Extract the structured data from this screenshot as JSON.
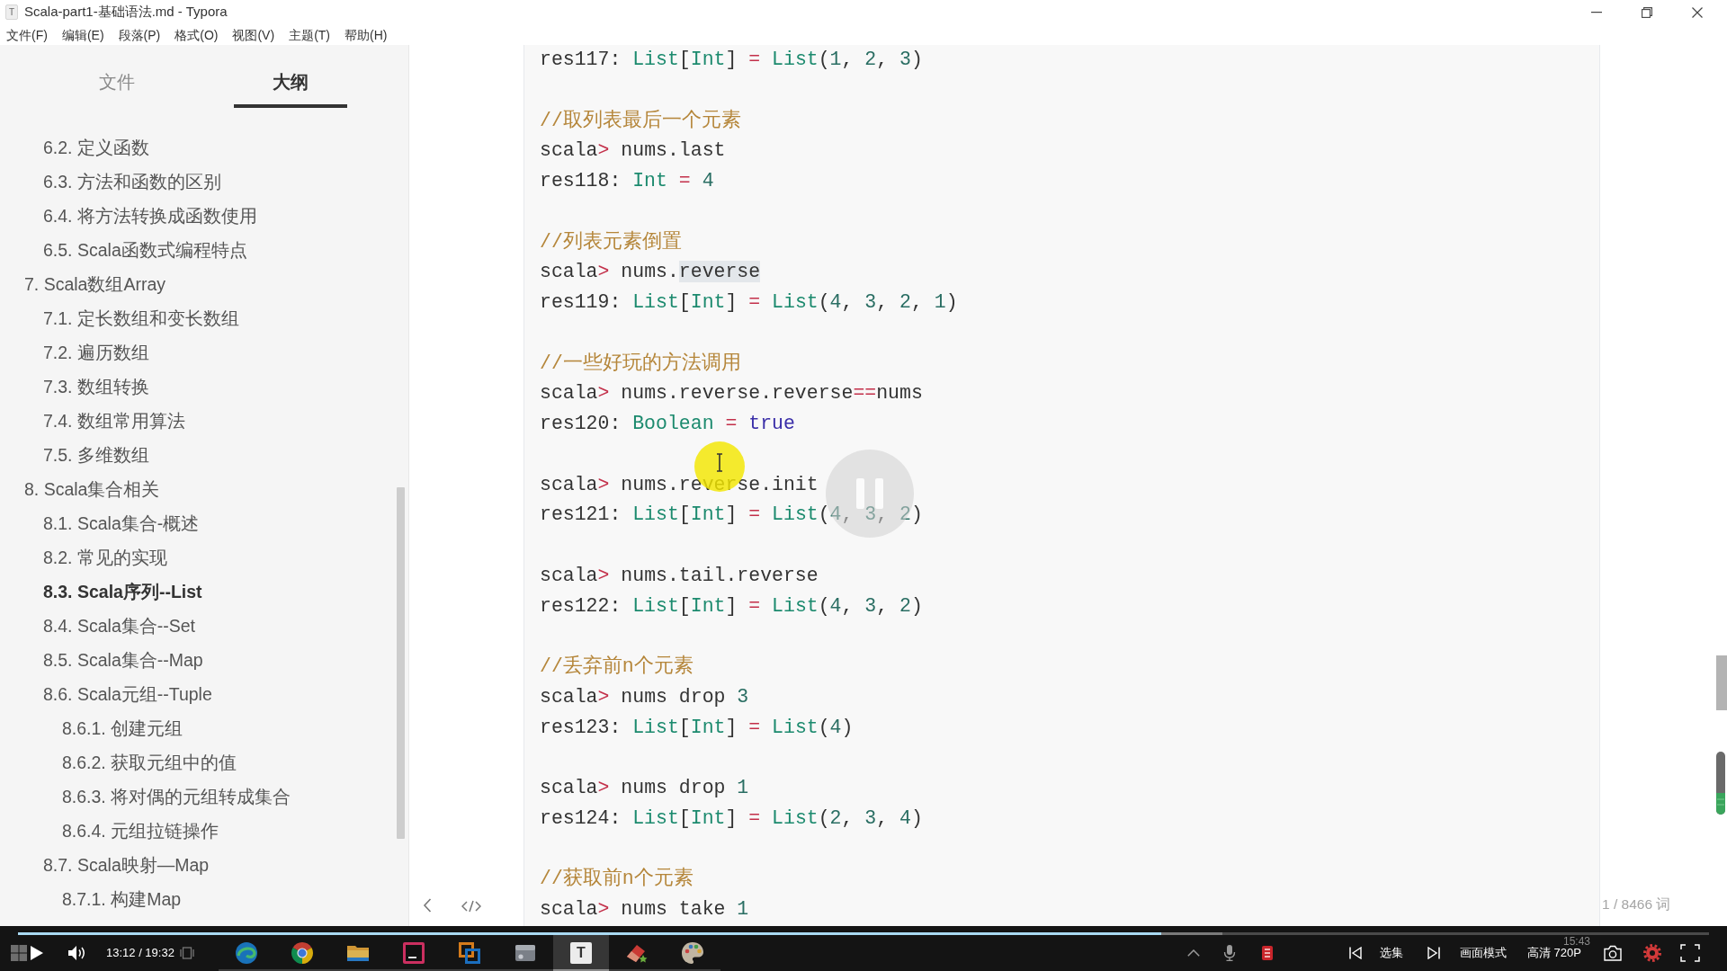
{
  "window": {
    "icon_glyph": "T",
    "title": "Scala-part1-基础语法.md - Typora"
  },
  "menu": [
    "文件(F)",
    "编辑(E)",
    "段落(P)",
    "格式(O)",
    "视图(V)",
    "主题(T)",
    "帮助(H)"
  ],
  "sidebar": {
    "tabs": [
      {
        "label": "文件",
        "selected": false
      },
      {
        "label": "大纲",
        "selected": true
      }
    ],
    "outline": [
      {
        "children": [
          {
            "label": "6.2. 定义函数",
            "selected": false
          },
          {
            "label": "6.3. 方法和函数的区别",
            "selected": false
          },
          {
            "label": "6.4. 将方法转换成函数使用",
            "selected": false
          },
          {
            "label": "6.5. Scala函数式编程特点",
            "selected": false
          }
        ]
      },
      {
        "label": "7. Scala数组Array",
        "selected": false,
        "children": [
          {
            "label": "7.1. 定长数组和变长数组",
            "selected": false
          },
          {
            "label": "7.2. 遍历数组",
            "selected": false
          },
          {
            "label": "7.3. 数组转换",
            "selected": false
          },
          {
            "label": "7.4. 数组常用算法",
            "selected": false
          },
          {
            "label": "7.5. 多维数组",
            "selected": false
          }
        ]
      },
      {
        "label": "8. Scala集合相关",
        "selected": false,
        "children": [
          {
            "label": "8.1. Scala集合-概述",
            "selected": false
          },
          {
            "label": "8.2. 常见的实现",
            "selected": false
          },
          {
            "label": "8.3. Scala序列--List",
            "selected": true
          },
          {
            "label": "8.4. Scala集合--Set",
            "selected": false
          },
          {
            "label": "8.5. Scala集合--Map",
            "selected": false
          },
          {
            "label": "8.6. Scala元组--Tuple",
            "selected": false,
            "children": [
              {
                "label": "8.6.1. 创建元组",
                "selected": false
              },
              {
                "label": "8.6.2. 获取元组中的值",
                "selected": false
              },
              {
                "label": "8.6.3. 将对偶的元组转成集合",
                "selected": false
              },
              {
                "label": "8.6.4. 元组拉链操作",
                "selected": false
              }
            ]
          },
          {
            "label": "8.7. Scala映射—Map",
            "selected": false,
            "children": [
              {
                "label": "8.7.1. 构建Map",
                "selected": false
              }
            ]
          }
        ]
      }
    ]
  },
  "editor": {
    "code_block": [
      {
        "lines": [
          {
            "tokens": [
              {
                "text": "res117: ",
                "kind": "plain"
              },
              {
                "text": "List",
                "kind": "type"
              },
              {
                "text": "[",
                "kind": "plain"
              },
              {
                "text": "Int",
                "kind": "type"
              },
              {
                "text": "] ",
                "kind": "plain"
              },
              {
                "text": "= ",
                "kind": "operator"
              },
              {
                "text": "List",
                "kind": "type"
              },
              {
                "text": "(",
                "kind": "plain"
              },
              {
                "text": "1",
                "kind": "number"
              },
              {
                "text": ", ",
                "kind": "plain"
              },
              {
                "text": "2",
                "kind": "number"
              },
              {
                "text": ", ",
                "kind": "plain"
              },
              {
                "text": "3",
                "kind": "number"
              },
              {
                "text": ")",
                "kind": "plain"
              }
            ]
          }
        ]
      },
      {
        "lines": [
          {
            "tokens": [
              {
                "text": "//取列表最后一个元素",
                "kind": "comment"
              }
            ]
          },
          {
            "tokens": [
              {
                "text": "scala",
                "kind": "plain"
              },
              {
                "text": ">",
                "kind": "operator"
              },
              {
                "text": " nums.last",
                "kind": "plain"
              }
            ]
          },
          {
            "tokens": [
              {
                "text": "res118: ",
                "kind": "plain"
              },
              {
                "text": "Int",
                "kind": "type"
              },
              {
                "text": " = ",
                "kind": "operator"
              },
              {
                "text": "4",
                "kind": "number"
              }
            ]
          }
        ]
      },
      {
        "lines": [
          {
            "tokens": [
              {
                "text": "//列表元素倒置",
                "kind": "comment"
              }
            ]
          },
          {
            "tokens": [
              {
                "text": "scala",
                "kind": "plain"
              },
              {
                "text": ">",
                "kind": "operator"
              },
              {
                "text": " nums.",
                "kind": "plain"
              },
              {
                "text": "reverse",
                "kind": "match"
              }
            ]
          },
          {
            "tokens": [
              {
                "text": "res119: ",
                "kind": "plain"
              },
              {
                "text": "List",
                "kind": "type"
              },
              {
                "text": "[",
                "kind": "plain"
              },
              {
                "text": "Int",
                "kind": "type"
              },
              {
                "text": "] ",
                "kind": "plain"
              },
              {
                "text": "= ",
                "kind": "operator"
              },
              {
                "text": "List",
                "kind": "type"
              },
              {
                "text": "(",
                "kind": "plain"
              },
              {
                "text": "4",
                "kind": "number"
              },
              {
                "text": ", ",
                "kind": "plain"
              },
              {
                "text": "3",
                "kind": "number"
              },
              {
                "text": ", ",
                "kind": "plain"
              },
              {
                "text": "2",
                "kind": "number"
              },
              {
                "text": ", ",
                "kind": "plain"
              },
              {
                "text": "1",
                "kind": "number"
              },
              {
                "text": ")",
                "kind": "plain"
              }
            ]
          }
        ]
      },
      {
        "lines": [
          {
            "tokens": [
              {
                "text": "//一些好玩的方法调用",
                "kind": "comment"
              }
            ]
          },
          {
            "tokens": [
              {
                "text": "scala",
                "kind": "plain"
              },
              {
                "text": ">",
                "kind": "operator"
              },
              {
                "text": " nums.reverse.reverse",
                "kind": "plain"
              },
              {
                "text": "==",
                "kind": "operator"
              },
              {
                "text": "nums",
                "kind": "plain"
              }
            ]
          },
          {
            "tokens": [
              {
                "text": "res120: ",
                "kind": "plain"
              },
              {
                "text": "Boolean",
                "kind": "type"
              },
              {
                "text": " = ",
                "kind": "operator"
              },
              {
                "text": "true",
                "kind": "atom"
              }
            ]
          }
        ]
      },
      {
        "lines": [
          {
            "tokens": [
              {
                "text": "scala",
                "kind": "plain"
              },
              {
                "text": ">",
                "kind": "operator"
              },
              {
                "text": " nums.reverse.init",
                "kind": "plain"
              }
            ]
          },
          {
            "tokens": [
              {
                "text": "res121: ",
                "kind": "plain"
              },
              {
                "text": "List",
                "kind": "type"
              },
              {
                "text": "[",
                "kind": "plain"
              },
              {
                "text": "Int",
                "kind": "type"
              },
              {
                "text": "] ",
                "kind": "plain"
              },
              {
                "text": "= ",
                "kind": "operator"
              },
              {
                "text": "List",
                "kind": "type"
              },
              {
                "text": "(",
                "kind": "plain"
              },
              {
                "text": "4",
                "kind": "number"
              },
              {
                "text": ", ",
                "kind": "plain"
              },
              {
                "text": "3",
                "kind": "number"
              },
              {
                "text": ", ",
                "kind": "plain"
              },
              {
                "text": "2",
                "kind": "number"
              },
              {
                "text": ")",
                "kind": "plain"
              }
            ]
          }
        ]
      },
      {
        "lines": [
          {
            "tokens": [
              {
                "text": "scala",
                "kind": "plain"
              },
              {
                "text": ">",
                "kind": "operator"
              },
              {
                "text": " nums.tail.reverse",
                "kind": "plain"
              }
            ]
          },
          {
            "tokens": [
              {
                "text": "res122: ",
                "kind": "plain"
              },
              {
                "text": "List",
                "kind": "type"
              },
              {
                "text": "[",
                "kind": "plain"
              },
              {
                "text": "Int",
                "kind": "type"
              },
              {
                "text": "] ",
                "kind": "plain"
              },
              {
                "text": "= ",
                "kind": "operator"
              },
              {
                "text": "List",
                "kind": "type"
              },
              {
                "text": "(",
                "kind": "plain"
              },
              {
                "text": "4",
                "kind": "number"
              },
              {
                "text": ", ",
                "kind": "plain"
              },
              {
                "text": "3",
                "kind": "number"
              },
              {
                "text": ", ",
                "kind": "plain"
              },
              {
                "text": "2",
                "kind": "number"
              },
              {
                "text": ")",
                "kind": "plain"
              }
            ]
          }
        ]
      },
      {
        "lines": [
          {
            "tokens": [
              {
                "text": "//丢弃前n个元素",
                "kind": "comment"
              }
            ]
          },
          {
            "tokens": [
              {
                "text": "scala",
                "kind": "plain"
              },
              {
                "text": ">",
                "kind": "operator"
              },
              {
                "text": " nums drop ",
                "kind": "plain"
              },
              {
                "text": "3",
                "kind": "number"
              }
            ]
          },
          {
            "tokens": [
              {
                "text": "res123: ",
                "kind": "plain"
              },
              {
                "text": "List",
                "kind": "type"
              },
              {
                "text": "[",
                "kind": "plain"
              },
              {
                "text": "Int",
                "kind": "type"
              },
              {
                "text": "] ",
                "kind": "plain"
              },
              {
                "text": "= ",
                "kind": "operator"
              },
              {
                "text": "List",
                "kind": "type"
              },
              {
                "text": "(",
                "kind": "plain"
              },
              {
                "text": "4",
                "kind": "number"
              },
              {
                "text": ")",
                "kind": "plain"
              }
            ]
          }
        ]
      },
      {
        "lines": [
          {
            "tokens": [
              {
                "text": "scala",
                "kind": "plain"
              },
              {
                "text": ">",
                "kind": "operator"
              },
              {
                "text": " nums drop ",
                "kind": "plain"
              },
              {
                "text": "1",
                "kind": "number"
              }
            ]
          },
          {
            "tokens": [
              {
                "text": "res124: ",
                "kind": "plain"
              },
              {
                "text": "List",
                "kind": "type"
              },
              {
                "text": "[",
                "kind": "plain"
              },
              {
                "text": "Int",
                "kind": "type"
              },
              {
                "text": "] ",
                "kind": "plain"
              },
              {
                "text": "= ",
                "kind": "operator"
              },
              {
                "text": "List",
                "kind": "type"
              },
              {
                "text": "(",
                "kind": "plain"
              },
              {
                "text": "2",
                "kind": "number"
              },
              {
                "text": ", ",
                "kind": "plain"
              },
              {
                "text": "3",
                "kind": "number"
              },
              {
                "text": ", ",
                "kind": "plain"
              },
              {
                "text": "4",
                "kind": "number"
              },
              {
                "text": ")",
                "kind": "plain"
              }
            ]
          }
        ]
      },
      {
        "lines": [
          {
            "tokens": [
              {
                "text": "//获取前n个元素",
                "kind": "comment"
              }
            ]
          },
          {
            "tokens": [
              {
                "text": "scala",
                "kind": "plain"
              },
              {
                "text": ">",
                "kind": "operator"
              },
              {
                "text": " nums take ",
                "kind": "plain"
              },
              {
                "text": "1",
                "kind": "number"
              }
            ]
          }
        ]
      }
    ],
    "word_count": "1 / 8466 词"
  },
  "player": {
    "progress": {
      "level": 0.676
    },
    "buffer": {
      "level": 0.712
    },
    "time": "13:12 / 19:32",
    "taskbar": [
      {
        "kind": "swirl",
        "selected": false
      },
      {
        "kind": "segmented",
        "selected": false
      },
      {
        "kind": "folder",
        "selected": false
      },
      {
        "kind": "square",
        "selected": false
      },
      {
        "kind": "squares",
        "selected": false
      },
      {
        "kind": "drive",
        "selected": false
      },
      {
        "kind": "letter",
        "glyph": "T",
        "selected": true
      },
      {
        "kind": "eraser",
        "selected": false
      },
      {
        "kind": "palette",
        "selected": false
      }
    ],
    "clock": "15:43",
    "episodes": "选集",
    "view_mode": "画面模式",
    "quality": "高清 720P"
  }
}
